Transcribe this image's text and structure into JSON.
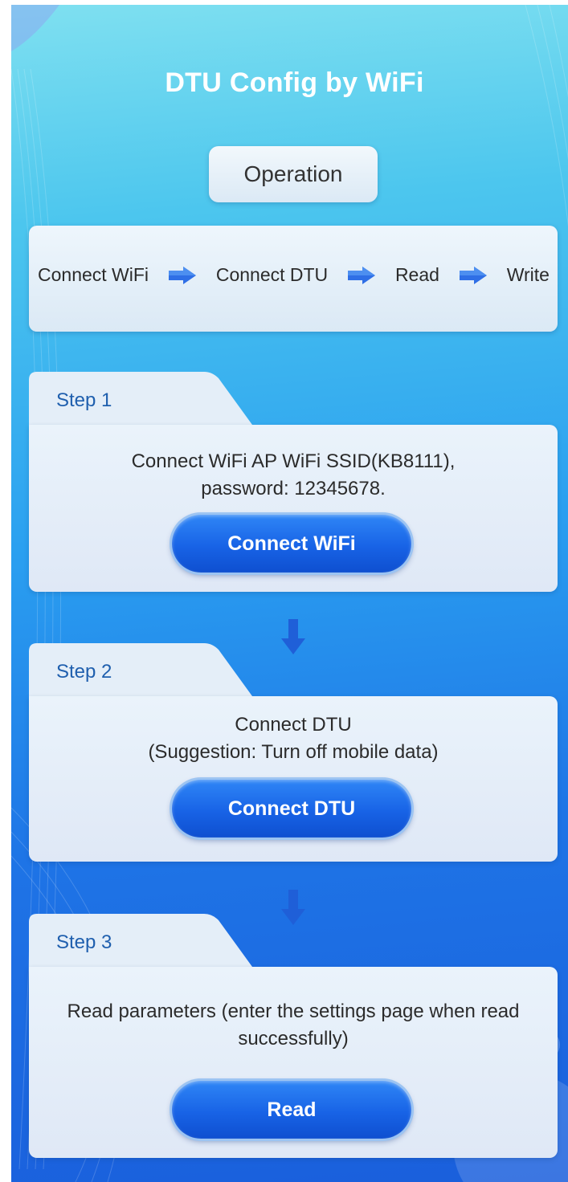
{
  "header": {
    "title": "DTU Config by WiFi"
  },
  "operation": {
    "label": "Operation"
  },
  "flow": {
    "steps": [
      "Connect WiFi",
      "Connect DTU",
      "Read",
      "Write"
    ]
  },
  "steps": [
    {
      "tab": "Step 1",
      "lines": [
        "Connect WiFi AP WiFi SSID(KB8111),",
        "password:  12345678."
      ],
      "button": "Connect WiFi"
    },
    {
      "tab": "Step 2",
      "lines": [
        "Connect DTU",
        "(Suggestion: Turn off mobile data)"
      ],
      "button": "Connect DTU"
    },
    {
      "tab": "Step 3",
      "lines": [
        "Read parameters (enter the settings page when read",
        "successfully)"
      ],
      "button": "Read"
    }
  ],
  "colors": {
    "accent_blue": "#1863e6",
    "step_label": "#1f5fae",
    "card_bg": "#eaf3fb"
  },
  "icons": {
    "flow_arrow": "right-arrow-icon",
    "down_arrow": "down-arrow-icon"
  }
}
